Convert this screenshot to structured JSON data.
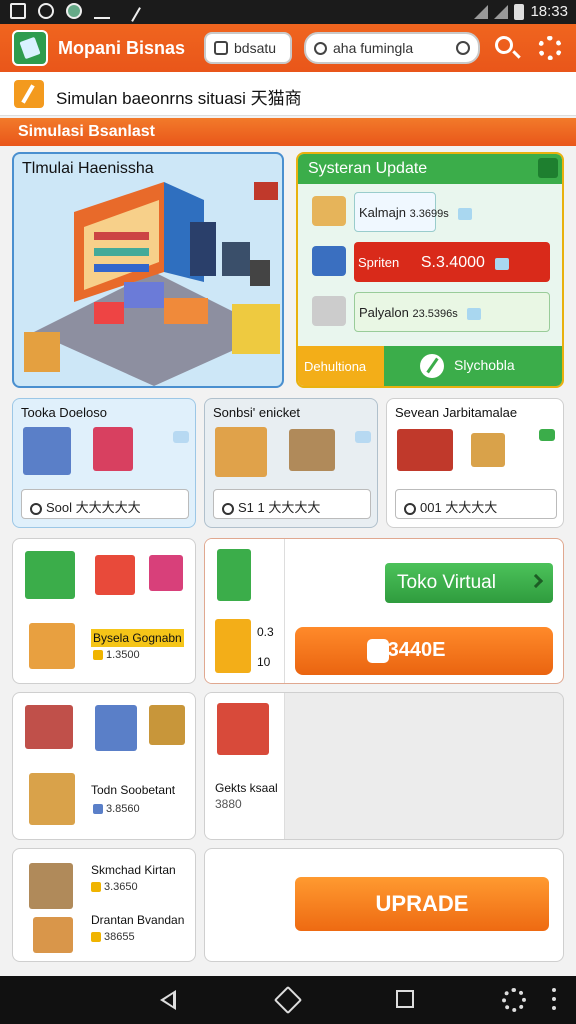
{
  "status_bar": {
    "time": "18:33"
  },
  "app_bar": {
    "title": "Mopani Bisnas",
    "field_one": "bdsatu",
    "search_placeholder": "aha fumingla"
  },
  "subheader": {
    "text": "Simulan baeonrns situasi 天猫商"
  },
  "section": {
    "title": "Simulasi Bsanlast"
  },
  "store_card": {
    "title": "Tlmulai Haenissha"
  },
  "update_card": {
    "title": "Systeran Update",
    "rows": [
      {
        "label": "Kalmajn",
        "value": "3.3699s"
      },
      {
        "label": "Spriten",
        "value": "S.3.4000"
      },
      {
        "label": "Palyalon",
        "value": "23.5396s"
      }
    ],
    "footer_left": "Dehultiona",
    "footer_right": "Slychobla"
  },
  "mid_cards": [
    {
      "title": "Tooka Doeloso",
      "field": "Sool  大大大大大"
    },
    {
      "title": "Sonbsi' enicket",
      "field": "S1 1  大大大大"
    },
    {
      "title": "Sevean Jarbitamalae",
      "field": "001  大大大大"
    }
  ],
  "row2": {
    "left_label": "Bysela Gognabn",
    "left_price": "1.3500",
    "right_small_1": "0.3",
    "right_small_2": "10",
    "green_button": "Toko Virtual",
    "orange_button": "2,3440E"
  },
  "row3": {
    "left_label": "Todn Soobetant",
    "left_price": "3.8560",
    "right_label": "Gekts ksaal",
    "right_value": "3880"
  },
  "row4": {
    "item1_label": "Skmchad Kirtan",
    "item1_price": "3.3650",
    "item2_label": "Drantan Bvandan",
    "item2_price": "38655",
    "upgrade_button": "UPRADE"
  },
  "colors": {
    "brand_orange": "#e9561a",
    "accent_green": "#3bad4a",
    "accent_red": "#d92a1a",
    "gold": "#f3ae18"
  }
}
